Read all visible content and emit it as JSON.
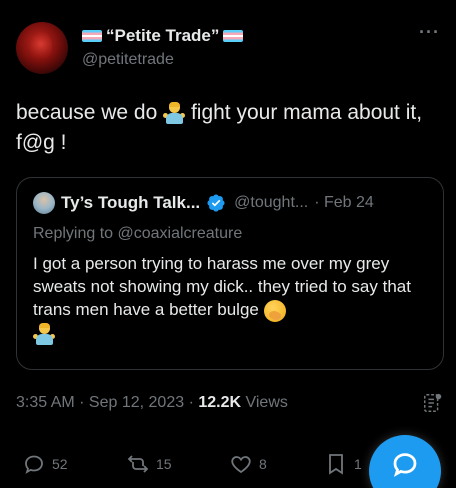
{
  "post": {
    "display_name": "“Petite Trade”",
    "handle": "@petitetrade",
    "more_label": "···",
    "text_before_emoji": "because we do ",
    "text_after_emoji": " fight your mama about it, f@g !"
  },
  "quote": {
    "display_name": "Ty’s Tough Talk...",
    "handle": "@tought...",
    "date": "· Feb 24",
    "replying_to": "Replying to @coaxialcreature",
    "text": "I got a person trying to harass me over my grey sweats not showing my dick.. they tried to say that trans men have a better bulge "
  },
  "meta": {
    "time": "3:35 AM",
    "sep1": " · ",
    "date": "Sep 12, 2023",
    "sep2": " · ",
    "views_count": "12.2K",
    "views_label": " Views"
  },
  "actions": {
    "replies": "52",
    "reposts": "15",
    "likes": "8",
    "bookmarks": "1"
  },
  "icons": [
    "trans-flag-icon",
    "verified-icon",
    "shrug-emoji-icon",
    "yawn-emoji-icon",
    "grok-icon",
    "reply-icon",
    "repost-icon",
    "like-icon",
    "bookmark-icon",
    "compose-icon"
  ],
  "colors": {
    "accent": "#1d9bf0",
    "muted": "#71767b",
    "text": "#e7e9ea",
    "border": "#2f3336"
  }
}
